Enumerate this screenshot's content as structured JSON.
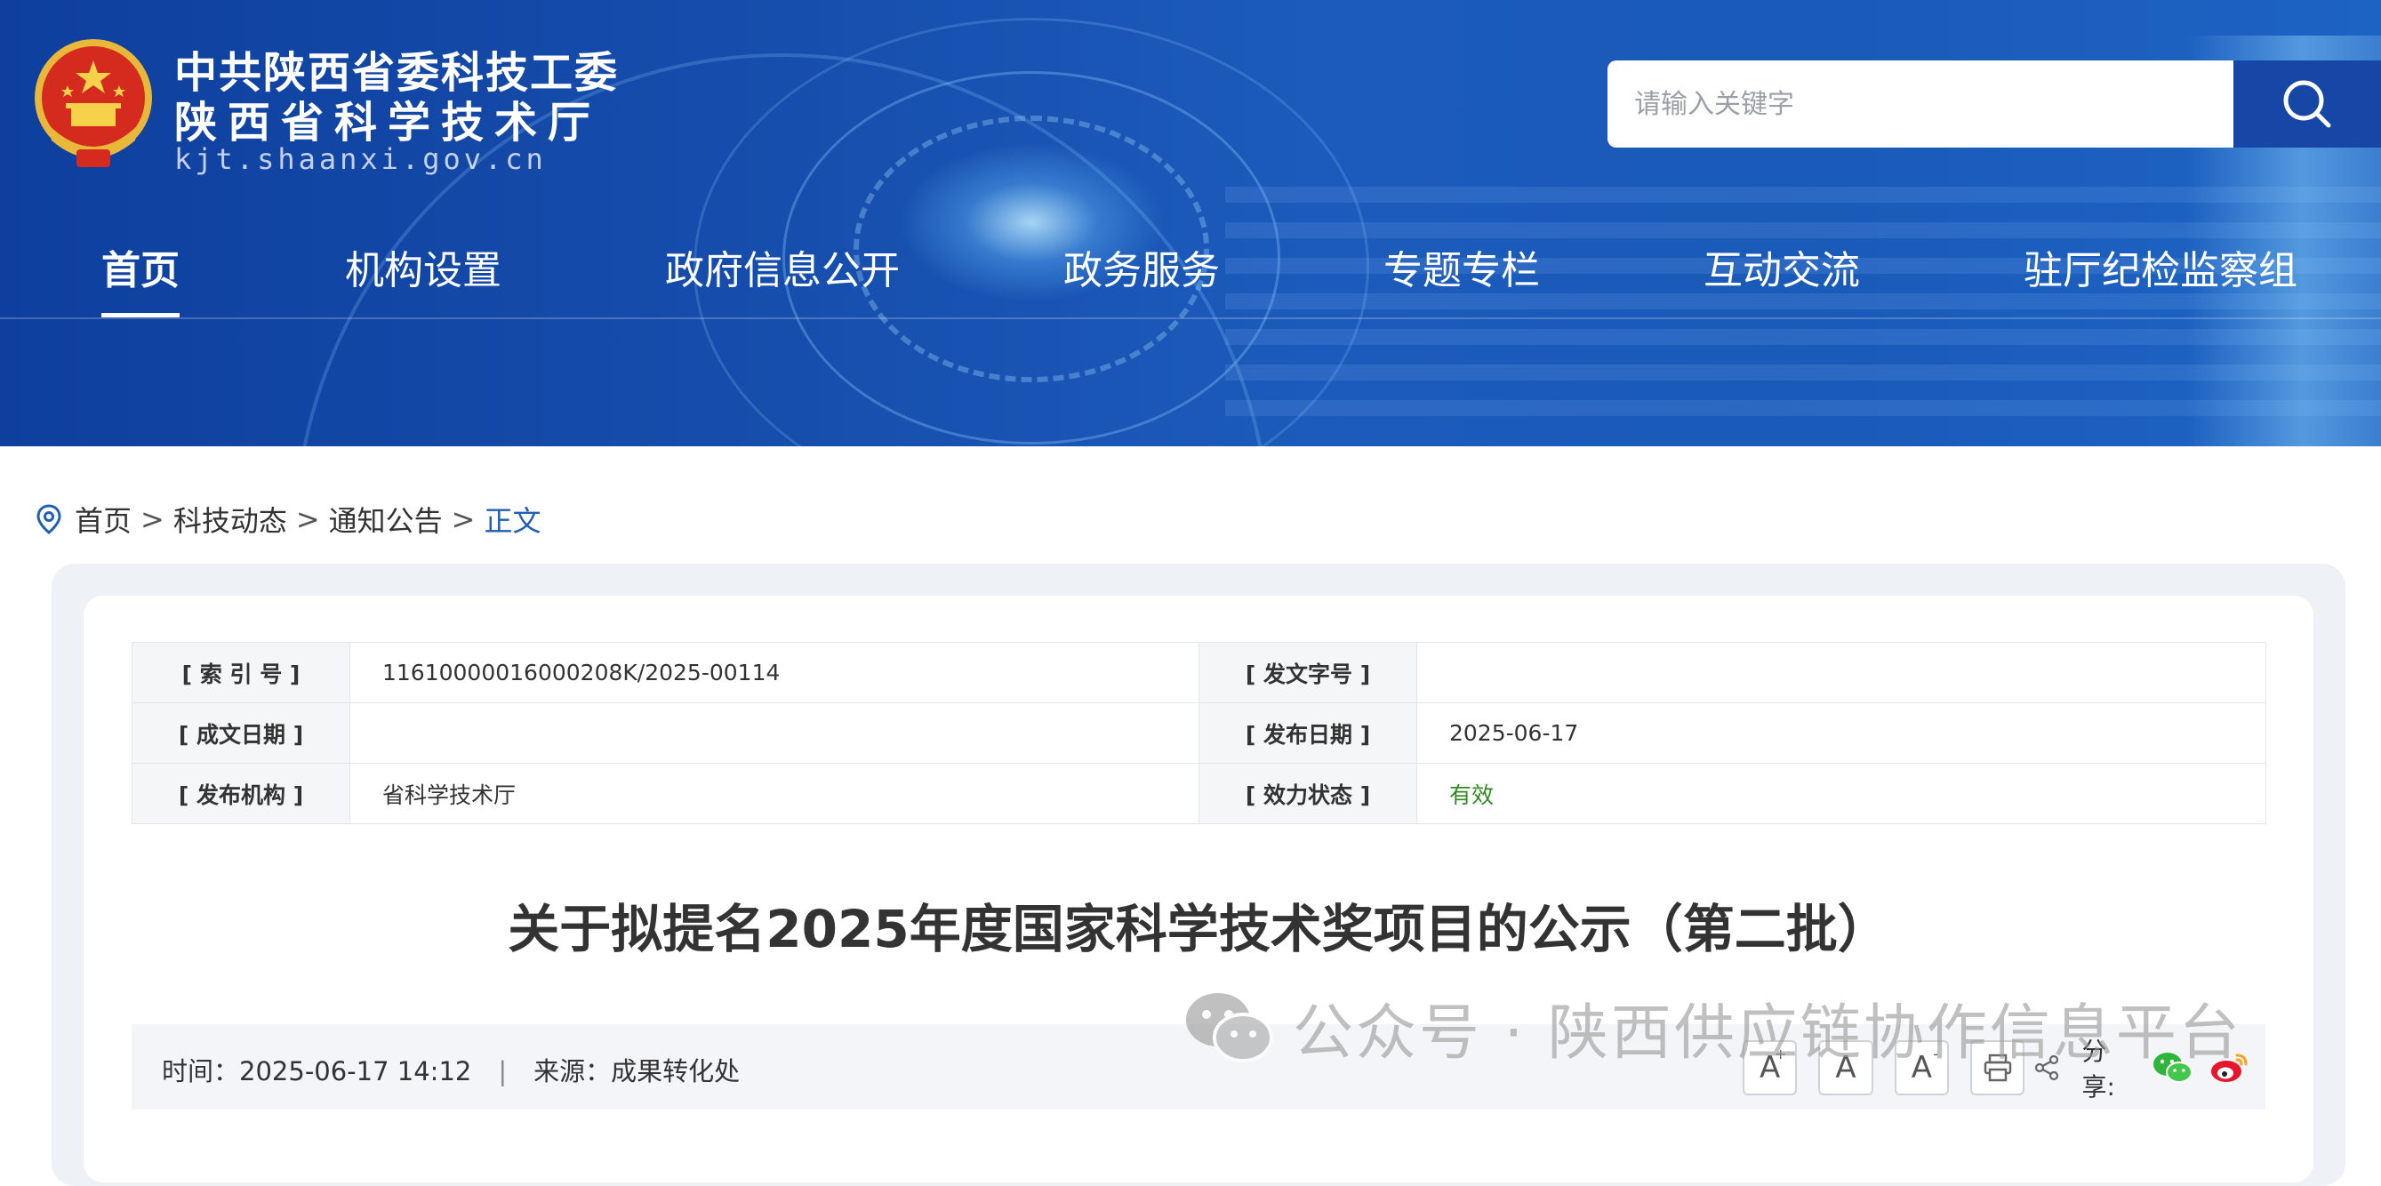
{
  "site": {
    "title_line1": "中共陕西省委科技工委",
    "title_line2": "陕西省科学技术厅",
    "domain": "kjt.shaanxi.gov.cn"
  },
  "search": {
    "placeholder": "请输入关键字",
    "value": ""
  },
  "nav": {
    "items": [
      {
        "label": "首页",
        "active": true
      },
      {
        "label": "机构设置"
      },
      {
        "label": "政府信息公开"
      },
      {
        "label": "政务服务"
      },
      {
        "label": "专题专栏"
      },
      {
        "label": "互动交流"
      },
      {
        "label": "驻厅纪检监察组"
      }
    ]
  },
  "breadcrumb": {
    "items": [
      "首页",
      "科技动态",
      "通知公告",
      "正文"
    ],
    "separator": ">"
  },
  "meta": {
    "index_label": "[ 索 引 号 ]",
    "index_value": "11610000016000208K/2025-00114",
    "docno_label": "[ 发文字号 ]",
    "docno_value": "",
    "created_label": "[ 成文日期 ]",
    "created_value": "",
    "published_label": "[ 发布日期 ]",
    "published_value": "2025-06-17",
    "org_label": "[ 发布机构 ]",
    "org_value": "省科学技术厅",
    "status_label": "[ 效力状态 ]",
    "status_value": "有效",
    "status_color": "#2e8b1f"
  },
  "article": {
    "title": "关于拟提名2025年度国家科学技术奖项目的公示（第二批）",
    "time_label": "时间：",
    "time_value": "2025-06-17 14:12",
    "divider": "|",
    "source_label": "来源：",
    "source_value": "成果转化处"
  },
  "tools": {
    "font_large": "A",
    "font_large_mark": "+",
    "font_medium": "A",
    "font_small": "A",
    "font_small_mark": "-",
    "share_label": "分享:",
    "icons": [
      "print-icon",
      "share-icon",
      "wechat-icon",
      "weibo-icon"
    ]
  },
  "watermark": {
    "text": "公众号 · 陕西供应链协作信息平台"
  },
  "colors": {
    "header_blue": "#174fae",
    "search_btn": "#1747a6",
    "breadcrumb_current": "#1f5fb6",
    "status_green": "#2e8b1f"
  }
}
